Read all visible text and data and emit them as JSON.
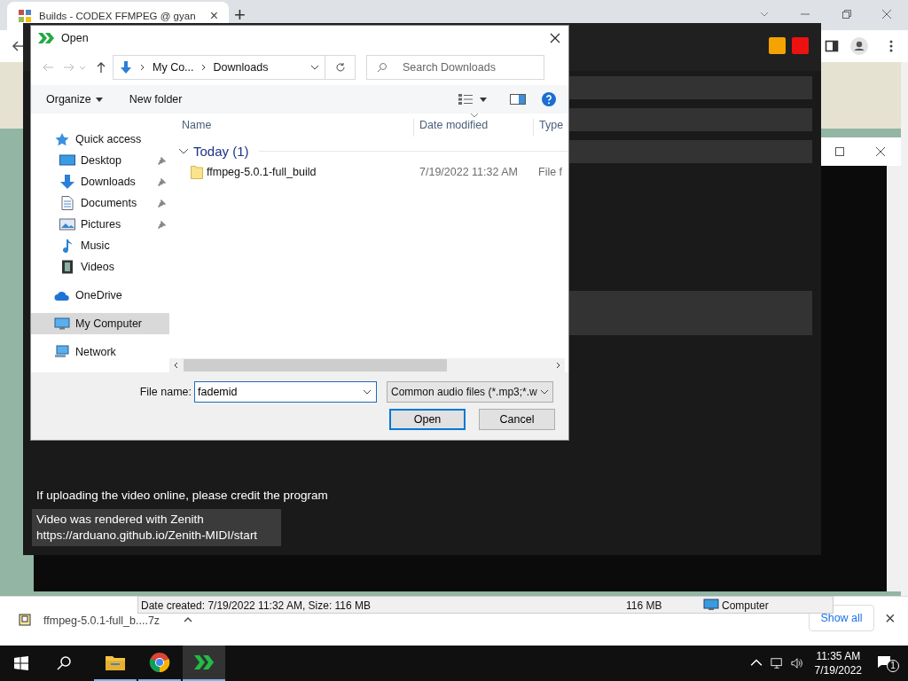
{
  "browser": {
    "tab_title": "Builds - CODEX FFMPEG @ gyan",
    "tab_close": "×",
    "new_tab": "+"
  },
  "download_bar": {
    "file": "ffmpeg-5.0.1-full_b....7z",
    "show_all": "Show all",
    "close": "×"
  },
  "behind_window": {
    "status": "Date created: 7/19/2022 11:32 AM, Size: 116 MB",
    "size": "116 MB",
    "location": "Computer"
  },
  "zenith": {
    "notice": "If uploading the video online, please credit the program",
    "credit_lines": [
      "Video was rendered with Zenith",
      "https://arduano.github.io/Zenith-MIDI/start"
    ]
  },
  "dialog": {
    "title": "Open",
    "breadcrumb": [
      "My Co...",
      "Downloads"
    ],
    "search_placeholder": "Search Downloads",
    "organize": "Organize",
    "new_folder": "New folder",
    "nav": [
      {
        "label": "Quick access",
        "kind": "star",
        "selected": false,
        "children": [
          {
            "label": "Desktop",
            "kind": "desktop",
            "pinned": true,
            "selected": false
          },
          {
            "label": "Downloads",
            "kind": "download",
            "pinned": true,
            "selected": false
          },
          {
            "label": "Documents",
            "kind": "document",
            "pinned": true,
            "selected": false
          },
          {
            "label": "Pictures",
            "kind": "pictures",
            "pinned": true,
            "selected": false
          },
          {
            "label": "Music",
            "kind": "music",
            "pinned": false,
            "selected": false
          },
          {
            "label": "Videos",
            "kind": "videos",
            "pinned": false,
            "selected": false
          }
        ]
      },
      {
        "label": "OneDrive",
        "kind": "cloud",
        "selected": false
      },
      {
        "label": "My Computer",
        "kind": "computer",
        "selected": true
      },
      {
        "label": "Network",
        "kind": "network",
        "selected": false
      }
    ],
    "columns": [
      "Name",
      "Date modified",
      "Type"
    ],
    "groups": [
      {
        "label": "Today (1)",
        "expanded": true,
        "files": [
          {
            "name": "ffmpeg-5.0.1-full_build",
            "date": "7/19/2022 11:32 AM",
            "type": "File f"
          }
        ]
      }
    ],
    "file_name_label": "File name:",
    "file_name": "fademid",
    "filter": "Common audio files (*.mp3;*.w",
    "buttons": [
      {
        "label": "Open",
        "default": true
      },
      {
        "label": "Cancel",
        "default": false
      }
    ]
  },
  "taskbar": {
    "apps": [
      {
        "kind": "explorer",
        "selected": false
      },
      {
        "kind": "chrome",
        "selected": false
      },
      {
        "kind": "zenith",
        "selected": true
      }
    ],
    "time": "11:35 AM",
    "date": "7/19/2022",
    "notifications": "1"
  }
}
